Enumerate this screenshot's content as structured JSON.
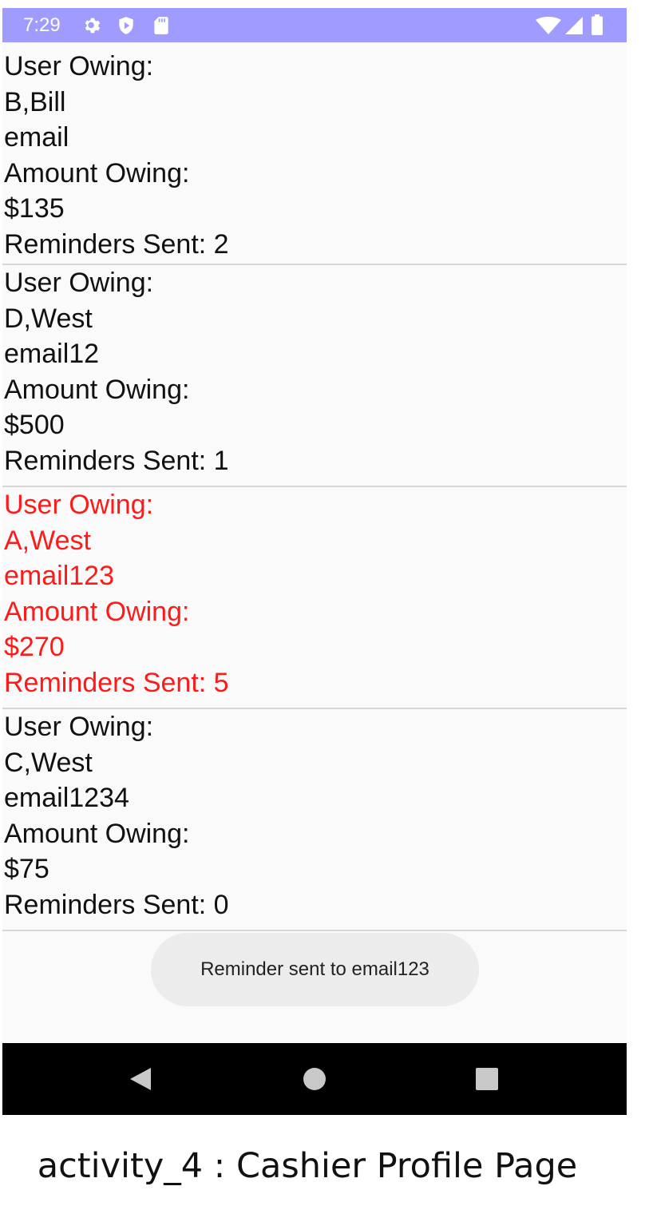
{
  "status_bar": {
    "time": "7:29",
    "background": "#a09cff",
    "icons": [
      "gear-icon",
      "shield-play-icon",
      "sd-card-icon",
      "wifi-icon",
      "signal-icon",
      "battery-icon"
    ]
  },
  "entries": [
    {
      "user_label": "User Owing:",
      "name": "B,Bill",
      "email": "email",
      "amount_label": "Amount Owing:",
      "amount": "$135",
      "reminders": "Reminders Sent: 2",
      "highlighted": false
    },
    {
      "user_label": "User Owing:",
      "name": "D,West",
      "email": "email12",
      "amount_label": "Amount Owing:",
      "amount": "$500",
      "reminders": "Reminders Sent: 1",
      "highlighted": false
    },
    {
      "user_label": "User Owing:",
      "name": "A,West",
      "email": "email123",
      "amount_label": "Amount Owing:",
      "amount": "$270",
      "reminders": "Reminders Sent: 5",
      "highlighted": true
    },
    {
      "user_label": "User Owing:",
      "name": "C,West",
      "email": "email1234",
      "amount_label": "Amount Owing:",
      "amount": "$75",
      "reminders": "Reminders Sent: 0",
      "highlighted": false
    }
  ],
  "toast": {
    "message": "Reminder sent to email123"
  },
  "nav_bar": {
    "icons": [
      "back-triangle-icon",
      "home-circle-icon",
      "recents-square-icon"
    ]
  },
  "colors": {
    "highlight": "#ff1a1a",
    "text": "#111111",
    "divider": "#d6d6d6"
  },
  "caption": "activity_4 : Cashier Profile Page"
}
